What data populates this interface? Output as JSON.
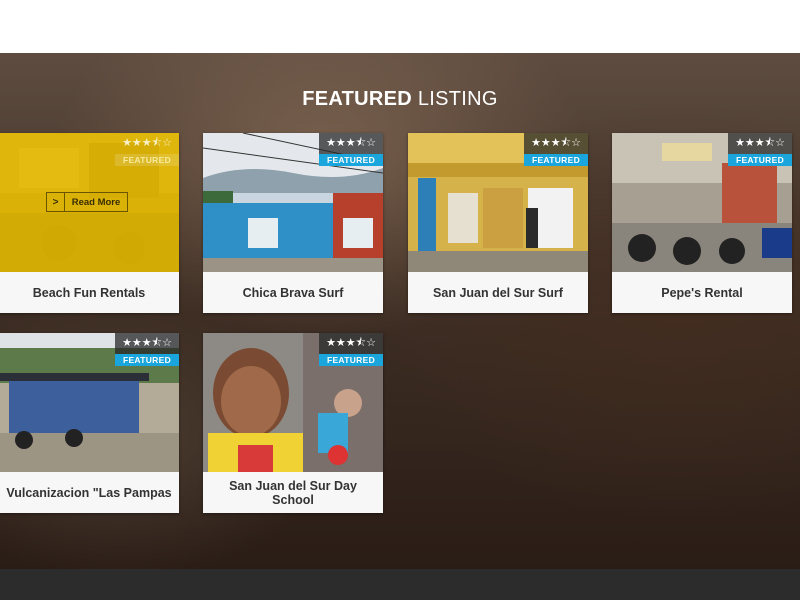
{
  "heading": {
    "strong": "FEATURED",
    "light": "LISTING"
  },
  "badge_text": "FEATURED",
  "colors": {
    "featured_badge": "#1aa6dc",
    "hover_overlay": "#f0c300",
    "footer": "#2c2c2c"
  },
  "listings": [
    {
      "title": "Beach Fun Rentals",
      "rating": 3.5,
      "stars": "★★★⯪☆",
      "read_more": "Read More"
    },
    {
      "title": "Chica Brava Surf",
      "rating": 3.5,
      "stars": "★★★⯪☆"
    },
    {
      "title": "San Juan del Sur Surf",
      "rating": 3.5,
      "stars": "★★★⯪☆"
    },
    {
      "title": "Pepe's Rental",
      "rating": 3.5,
      "stars": "★★★⯪☆"
    },
    {
      "title": "Vulcanizacion \"Las Pampas",
      "rating": 3.5,
      "stars": "★★★⯪☆"
    },
    {
      "title": "San Juan del Sur Day School",
      "rating": 3.5,
      "stars": "★★★⯪☆"
    }
  ]
}
